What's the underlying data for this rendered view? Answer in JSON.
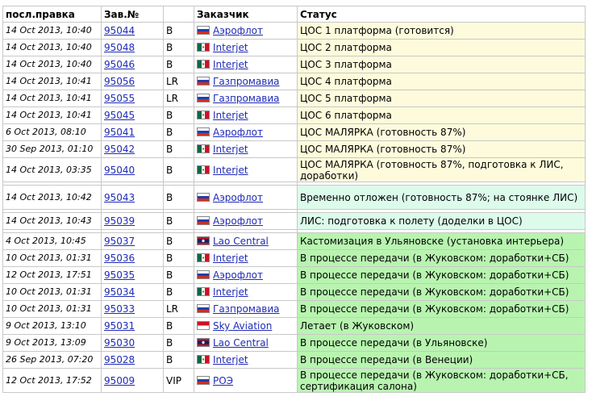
{
  "headers": {
    "date": "посл.правка",
    "order": "Зав.№",
    "type": "",
    "customer": "Заказчик",
    "status": "Статус"
  },
  "rows": [
    {
      "date": "14 Oct 2013, 10:40",
      "num": "95044",
      "type": "B",
      "flag": "russia-flag-icon",
      "customer": "Аэрофлот",
      "status": "ЦОС 1 платформа (готовится)",
      "color": "yellow",
      "tall": false
    },
    {
      "date": "14 Oct 2013, 10:40",
      "num": "95048",
      "type": "B",
      "flag": "mexico-flag-icon",
      "customer": "Interjet",
      "status": "ЦОС 2 платформа",
      "color": "yellow",
      "tall": false
    },
    {
      "date": "14 Oct 2013, 10:40",
      "num": "95046",
      "type": "B",
      "flag": "mexico-flag-icon",
      "customer": "Interjet",
      "status": "ЦОС 3 платформа",
      "color": "yellow",
      "tall": false
    },
    {
      "date": "14 Oct 2013, 10:41",
      "num": "95056",
      "type": "LR",
      "flag": "russia-flag-icon",
      "customer": "Газпромавиа",
      "status": "ЦОС 4 платформа",
      "color": "yellow",
      "tall": false
    },
    {
      "date": "14 Oct 2013, 10:41",
      "num": "95055",
      "type": "LR",
      "flag": "russia-flag-icon",
      "customer": "Газпромавиа",
      "status": "ЦОС 5 платформа",
      "color": "yellow",
      "tall": false
    },
    {
      "date": "14 Oct 2013, 10:41",
      "num": "95045",
      "type": "B",
      "flag": "mexico-flag-icon",
      "customer": "Interjet",
      "status": "ЦОС 6 платформа",
      "color": "yellow",
      "tall": false
    },
    {
      "date": "6 Oct 2013, 08:10",
      "num": "95041",
      "type": "B",
      "flag": "russia-flag-icon",
      "customer": "Аэрофлот",
      "status": "ЦОС МАЛЯРКА (готовность 87%)",
      "color": "yellow",
      "tall": false
    },
    {
      "date": "30 Sep 2013, 01:10",
      "num": "95042",
      "type": "B",
      "flag": "mexico-flag-icon",
      "customer": "Interjet",
      "status": "ЦОС МАЛЯРКА (готовность 87%)",
      "color": "yellow",
      "tall": false
    },
    {
      "date": "14 Oct 2013, 03:35",
      "num": "95040",
      "type": "B",
      "flag": "mexico-flag-icon",
      "customer": "Interjet",
      "status": "ЦОС МАЛЯРКА (готовность 87%, подготовка к ЛИС, доработки)",
      "color": "yellow",
      "tall": true
    },
    {
      "sep": true
    },
    {
      "date": "14 Oct 2013, 10:42",
      "num": "95043",
      "type": "B",
      "flag": "russia-flag-icon",
      "customer": "Аэрофлот",
      "status": "Временно отложен (готовность 87%; на стоянке ЛИС)",
      "color": "mint",
      "tall": true
    },
    {
      "sep": true
    },
    {
      "date": "14 Oct 2013, 10:43",
      "num": "95039",
      "type": "B",
      "flag": "russia-flag-icon",
      "customer": "Аэрофлот",
      "status": "ЛИС: подготовка к полету (доделки в ЦОС)",
      "color": "mint",
      "tall": false
    },
    {
      "sep": true
    },
    {
      "date": "4 Oct 2013, 10:45",
      "num": "95037",
      "type": "B",
      "flag": "laos-flag-icon",
      "customer": "Lao Central",
      "status": "Кастомизация в Ульяновске (установка интерьера)",
      "color": "green",
      "tall": false
    },
    {
      "date": "10 Oct 2013, 01:31",
      "num": "95036",
      "type": "B",
      "flag": "mexico-flag-icon",
      "customer": "Interjet",
      "status": "В процессе передачи (в Жуковском: доработки+СБ)",
      "color": "green",
      "tall": false
    },
    {
      "date": "12 Oct 2013, 17:51",
      "num": "95035",
      "type": "B",
      "flag": "russia-flag-icon",
      "customer": "Аэрофлот",
      "status": "В процессе передачи (в Жуковском: доработки+СБ)",
      "color": "green",
      "tall": false
    },
    {
      "date": "10 Oct 2013, 01:31",
      "num": "95034",
      "type": "B",
      "flag": "mexico-flag-icon",
      "customer": "Interjet",
      "status": "В процессе передачи (в Жуковском: доработки+СБ)",
      "color": "green",
      "tall": false
    },
    {
      "date": "10 Oct 2013, 01:31",
      "num": "95033",
      "type": "LR",
      "flag": "russia-flag-icon",
      "customer": "Газпромавиа",
      "status": "В процессе передачи (в Жуковском: доработки+СБ)",
      "color": "green",
      "tall": false
    },
    {
      "date": "9 Oct 2013, 13:10",
      "num": "95031",
      "type": "B",
      "flag": "indonesia-flag-icon",
      "customer": "Sky Aviation",
      "status": "Летает (в Жуковском)",
      "color": "green",
      "tall": false
    },
    {
      "date": "9 Oct 2013, 13:09",
      "num": "95030",
      "type": "B",
      "flag": "laos-flag-icon",
      "customer": "Lao Central",
      "status": "В процессе передачи (в Ульяновске)",
      "color": "green",
      "tall": false
    },
    {
      "date": "26 Sep 2013, 07:20",
      "num": "95028",
      "type": "B",
      "flag": "mexico-flag-icon",
      "customer": "Interjet",
      "status": "В процессе передачи (в Венеции)",
      "color": "green",
      "tall": false
    },
    {
      "date": "12 Oct 2013, 17:52",
      "num": "95009",
      "type": "VIP",
      "flag": "russia-flag-icon",
      "customer": "РОЭ",
      "status": "В процессе передачи (в Жуковском: доработки+СБ, сертификация салона)",
      "color": "green",
      "tall": true
    }
  ]
}
